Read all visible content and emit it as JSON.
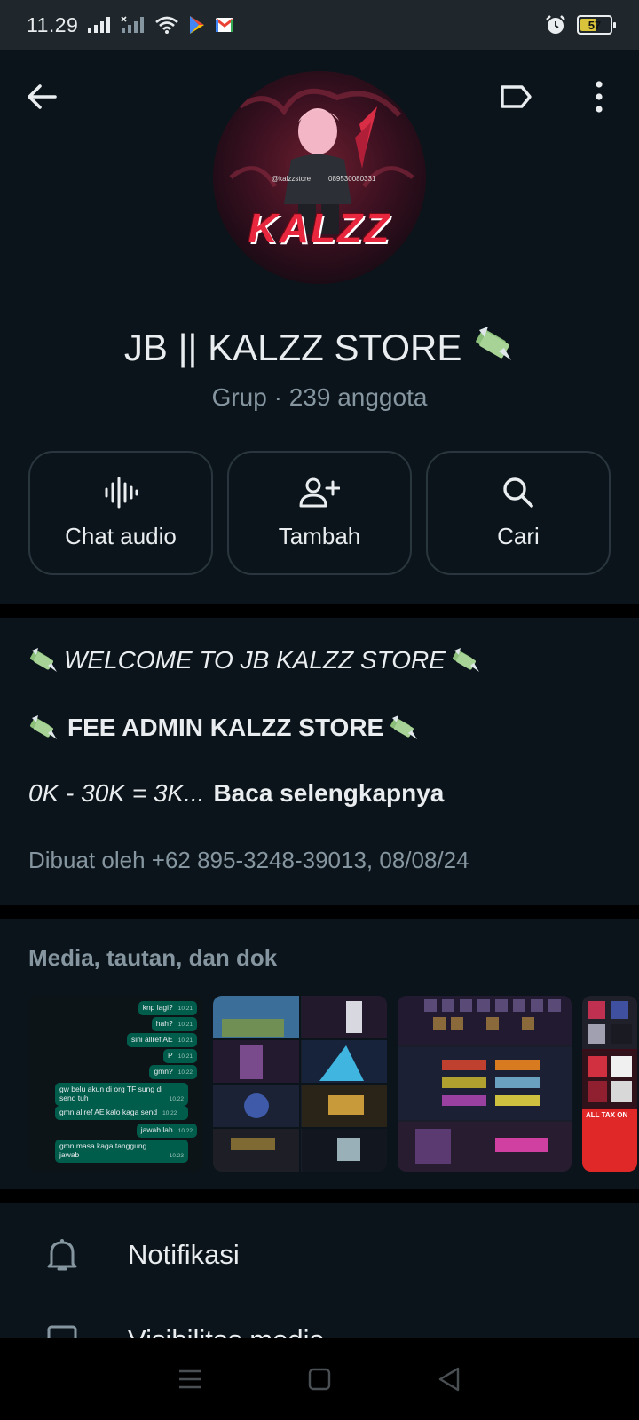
{
  "status_bar": {
    "time": "11.29",
    "battery_level": "57",
    "battery_percent": 57,
    "icons": [
      "signal-icon",
      "signal-x-icon",
      "wifi-icon",
      "play-store-icon",
      "gmail-icon",
      "alarm-icon",
      "battery-icon"
    ]
  },
  "header": {
    "back_icon": "arrow-left-icon",
    "label_icon": "label-tag-icon",
    "menu_icon": "more-vertical-icon",
    "avatar_text": "KALZZ",
    "avatar_handle": "@kalzzstore",
    "avatar_phone": "089530080331"
  },
  "group": {
    "name": "JB || KALZZ STORE",
    "subtitle": "Grup · 239 anggota"
  },
  "actions": [
    {
      "label": "Chat audio",
      "icon": "audio-wave-icon"
    },
    {
      "label": "Tambah",
      "icon": "add-person-icon"
    },
    {
      "label": "Cari",
      "icon": "search-icon"
    }
  ],
  "description": {
    "line1": "WELCOME TO JB KALZZ STORE",
    "line2": "FEE ADMIN KALZZ STORE",
    "line3_text": "0K - 30K = 3K...",
    "read_more": "Baca selengkapnya",
    "created": "Dibuat oleh +62 895-3248-39013, 08/08/24"
  },
  "media": {
    "title": "Media, tautan, dan dok",
    "chat_thumb_messages": [
      {
        "text": "knp lagi?",
        "time": "10.21"
      },
      {
        "text": "hah?",
        "time": "10.21"
      },
      {
        "text": "sini allref AE",
        "time": "10.21"
      },
      {
        "text": "P",
        "time": "10.21"
      },
      {
        "text": "gmn?",
        "time": "10.22"
      },
      {
        "text": "gw belu akun di org TF sung di send tuh",
        "time": "10.22"
      },
      {
        "text": "gmn allref AE kalo kaga send",
        "time": "10.22"
      },
      {
        "text": "jawab lah",
        "time": "10.22"
      },
      {
        "text": "gmn masa kaga tanggung jawab",
        "time": "10.23"
      }
    ],
    "partial_thumb_text": "ALL TAX ON"
  },
  "list": [
    {
      "label": "Notifikasi",
      "icon": "bell-icon"
    },
    {
      "label": "Visibilitas media",
      "icon": "image-icon"
    }
  ],
  "nav": {
    "icons": [
      "menu-icon",
      "home-square-icon",
      "back-triangle-icon"
    ]
  },
  "colors": {
    "background": "#0b141a",
    "status_bar": "#1f272c",
    "text_primary": "#e9edef",
    "text_secondary": "#8696a0",
    "bubble_green": "#005c4b",
    "card_border": "#2a363e"
  }
}
